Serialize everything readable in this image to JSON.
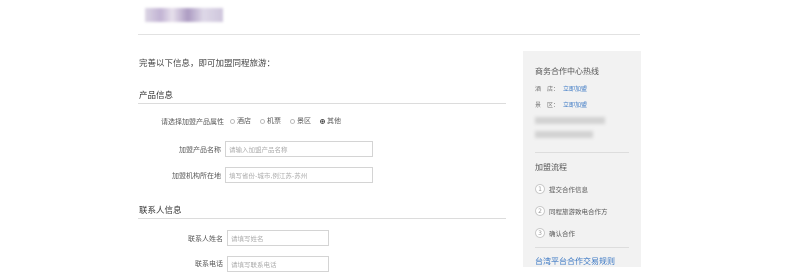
{
  "intro": "完善以下信息，即可加盟同程旅游：",
  "product_section": {
    "title": "产品信息",
    "attribute_label": "请选择加盟产品属性",
    "attribute_options": [
      "酒店",
      "机票",
      "景区",
      "其他"
    ],
    "name_label": "加盟产品名称",
    "name_placeholder": "请输入加盟产品名称",
    "location_label": "加盟机构所在地",
    "location_placeholder": "填写省份-城市,例江苏-苏州"
  },
  "contact_section": {
    "title": "联系人信息",
    "name_label": "联系人姓名",
    "name_placeholder": "请填写姓名",
    "phone_label": "联系电话",
    "phone_placeholder": "请填写联系电话"
  },
  "sidebar": {
    "hotline_title": "商务合作中心热线",
    "hotel_label": "酒　店：",
    "hotel_link": "立即加盟",
    "scenic_label": "景　区：",
    "scenic_link": "立即加盟",
    "process_title": "加盟流程",
    "steps": [
      {
        "num": "1",
        "label": "提交合作信息"
      },
      {
        "num": "2",
        "label": "同程旅游致电合作方"
      },
      {
        "num": "3",
        "label": "确认合作"
      }
    ],
    "rules_link": "台湾平台合作交易规则"
  },
  "colors": {
    "link": "#3b78c4",
    "sidebar_bg": "#f2f2f2"
  }
}
